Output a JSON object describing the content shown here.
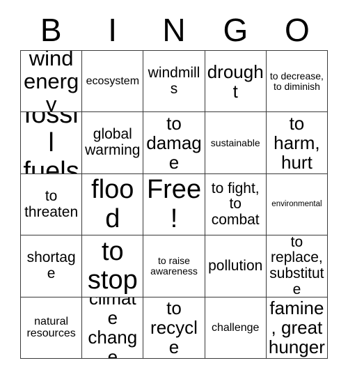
{
  "card": {
    "title_letters": [
      "B",
      "I",
      "N",
      "G",
      "O"
    ],
    "free_space_label": "Free!",
    "rows": [
      [
        {
          "text": "wind energy"
        },
        {
          "text": "ecosystem"
        },
        {
          "text": "windmills"
        },
        {
          "text": "drought"
        },
        {
          "text": "to decrease, to diminish"
        }
      ],
      [
        {
          "text": "fossil fuels"
        },
        {
          "text": "global warming"
        },
        {
          "text": "to damage"
        },
        {
          "text": "sustainable"
        },
        {
          "text": "to harm, hurt"
        }
      ],
      [
        {
          "text": "to threaten"
        },
        {
          "text": "flood"
        },
        {
          "text": "Free!"
        },
        {
          "text": "to fight, to combat"
        },
        {
          "text": "environmental"
        }
      ],
      [
        {
          "text": "shortage"
        },
        {
          "text": "to stop"
        },
        {
          "text": "to raise awareness"
        },
        {
          "text": "pollution"
        },
        {
          "text": "to replace, substitute"
        }
      ],
      [
        {
          "text": "natural resources"
        },
        {
          "text": "climate change"
        },
        {
          "text": "to recycle"
        },
        {
          "text": "challenge"
        },
        {
          "text": "famine, great hunger"
        }
      ]
    ]
  },
  "colors": {
    "background": "#ffffff",
    "text": "#000000",
    "grid_line": "#3a3a3a"
  }
}
